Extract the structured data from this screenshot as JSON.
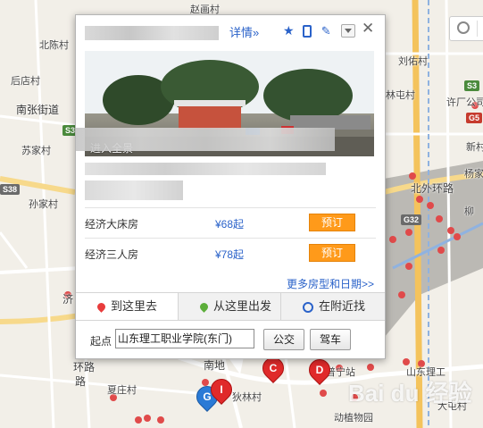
{
  "map": {
    "places": [
      {
        "name": "赵画村"
      },
      {
        "name": "北陈村"
      },
      {
        "name": "后店村"
      },
      {
        "name": "南张街道"
      },
      {
        "name": "苏家村"
      },
      {
        "name": "孙家村"
      },
      {
        "name": "刘佑村"
      },
      {
        "name": "林屯村"
      },
      {
        "name": "许厂公司"
      },
      {
        "name": "新村"
      },
      {
        "name": "杨家"
      },
      {
        "name": "柳"
      },
      {
        "name": "夏庄村"
      },
      {
        "name": "狄林村"
      },
      {
        "name": "普宁站"
      },
      {
        "name": "动植物园"
      },
      {
        "name": "山东理工"
      },
      {
        "name": "大屯村"
      }
    ],
    "roads": [
      {
        "name": "北外环路"
      },
      {
        "name": "济"
      },
      {
        "name": "环路"
      },
      {
        "name": "路"
      },
      {
        "name": "南地"
      }
    ],
    "shields": [
      {
        "code": "S3"
      },
      {
        "code": "S3"
      },
      {
        "code": "G5"
      },
      {
        "code": "S38"
      },
      {
        "code": "G32"
      }
    ],
    "letter_markers": [
      {
        "label": "G",
        "color": "blue"
      },
      {
        "label": "I",
        "color": "red"
      },
      {
        "label": "C",
        "color": "red"
      },
      {
        "label": "D",
        "color": "red"
      }
    ],
    "watermark": "Bai du 经验"
  },
  "popup": {
    "detail_link": "详情»",
    "close": "✕",
    "photo_caption": "进入全景",
    "rooms": [
      {
        "name": "经济大床房",
        "price": "¥68起",
        "button": "预订"
      },
      {
        "name": "经济三人房",
        "price": "¥78起",
        "button": "预订"
      }
    ],
    "more_link": "更多房型和日期>>",
    "tabs": [
      {
        "label": "到这里去"
      },
      {
        "label": "从这里出发"
      },
      {
        "label": "在附近找"
      }
    ],
    "start_label": "起点",
    "start_value": "山东理工职业学院(东门)",
    "bus_button": "公交",
    "car_button": "驾车"
  }
}
